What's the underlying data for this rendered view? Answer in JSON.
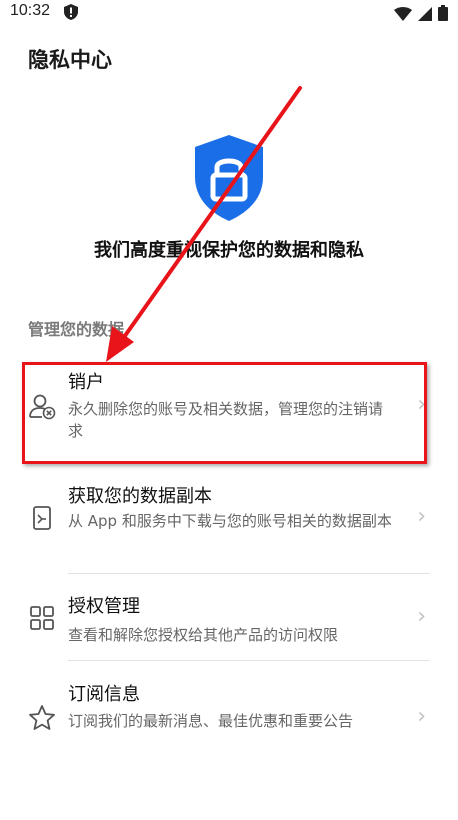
{
  "status": {
    "time": "10:32"
  },
  "header": {
    "title": "隐私中心"
  },
  "hero": {
    "text": "我们高度重视保护您的数据和隐私"
  },
  "section": {
    "title": "管理您的数据"
  },
  "items": [
    {
      "title": "销户",
      "desc": "永久删除您的账号及相关数据，管理您的注销请求",
      "icon": "person-remove-icon"
    },
    {
      "title": "获取您的数据副本",
      "desc": "从 App 和服务中下载与您的账号相关的数据副本",
      "icon": "data-copy-icon"
    },
    {
      "title": "授权管理",
      "desc": "查看和解除您授权给其他产品的访问权限",
      "icon": "grid-icon"
    },
    {
      "title": "订阅信息",
      "desc": "订阅我们的最新消息、最佳优惠和重要公告",
      "icon": "star-icon"
    }
  ],
  "colors": {
    "accent": "#1a6fe8",
    "annotation": "#e8141a"
  }
}
